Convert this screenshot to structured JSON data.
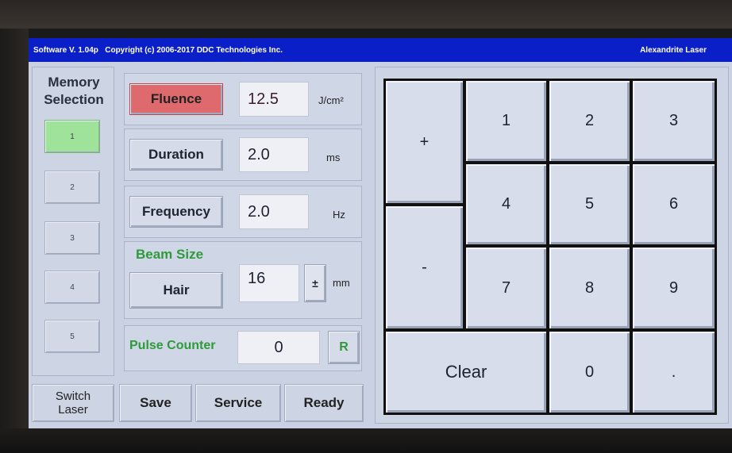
{
  "title_bar": {
    "software": "Software V. 1.04p",
    "copyright": "Copyright (c) 2006-2017 DDC Technologies Inc.",
    "laser_type": "Alexandrite Laser"
  },
  "memory": {
    "title_line1": "Memory",
    "title_line2": "Selection",
    "slots": [
      "1",
      "2",
      "3",
      "4",
      "5"
    ],
    "selected_slot": "1"
  },
  "params": {
    "fluence": {
      "label": "Fluence",
      "value": "12.5",
      "unit": "J/cm²"
    },
    "duration": {
      "label": "Duration",
      "value": "2.0",
      "unit": "ms"
    },
    "frequency": {
      "label": "Frequency",
      "value": "2.0",
      "unit": "Hz"
    },
    "beam_size": {
      "label": "Beam Size",
      "mode": "Hair",
      "value": "16",
      "toggle": "±",
      "unit": "mm"
    }
  },
  "pulse_counter": {
    "label": "Pulse Counter",
    "value": "0",
    "reset": "R"
  },
  "bottom": {
    "switch_line1": "Switch",
    "switch_line2": "Laser",
    "save": "Save",
    "service": "Service",
    "ready": "Ready"
  },
  "keypad": {
    "plus": "+",
    "minus": "-",
    "k1": "1",
    "k2": "2",
    "k3": "3",
    "k4": "4",
    "k5": "5",
    "k6": "6",
    "k7": "7",
    "k8": "8",
    "k9": "9",
    "clear": "Clear",
    "k0": "0",
    "dot": "."
  },
  "colors": {
    "title_bar": "#0a1fc8",
    "fluence_active": "#de6a6e",
    "memory_active": "#9fe39a",
    "green_label": "#2f9a3a"
  }
}
